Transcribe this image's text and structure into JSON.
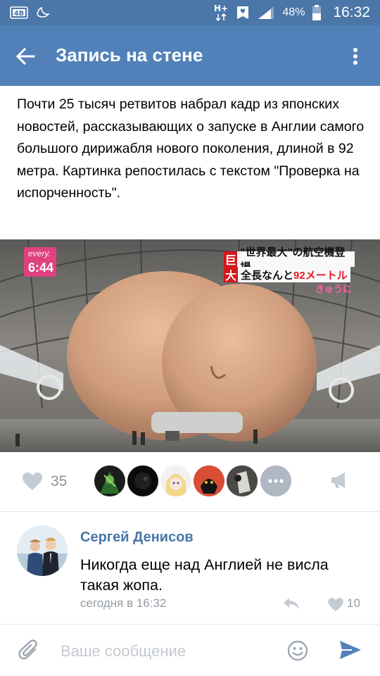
{
  "status_bar": {
    "sim_label": "4B",
    "network": "H+",
    "battery": "48%",
    "time": "16:32",
    "icons": [
      "sim-icon",
      "moon-icon",
      "data-arrows-icon",
      "heart-notification-icon",
      "signal-icon",
      "battery-icon"
    ]
  },
  "app_bar": {
    "title": "Запись на стене",
    "back_icon": "arrow-back-icon",
    "menu_icon": "more-vertical-icon",
    "color": "#5181b8"
  },
  "post": {
    "text": "Почти 25 тысяч ретвитов набрал кадр из японских новостей, рассказывающих о запуске в Англии самого большого дирижабля нового поколения, длиной в 92 метра. Картинка репостилась с текстом \"Проверка на испорченность\".",
    "photo": {
      "channel_label": "every.",
      "clock": "6:44",
      "caption_kanji_1": "巨",
      "caption_kanji_2": "大",
      "caption_line_1": "\"世界最大\"の航空機登場",
      "caption_line_2_prefix": "全長なんと",
      "caption_line_2_highlight": "92メートル",
      "caption_small": "きゅうに"
    }
  },
  "likes": {
    "count": "35",
    "like_icon": "heart-icon",
    "more_icon": "more-horizontal-icon",
    "share_icon": "megaphone-icon"
  },
  "comment": {
    "author": "Сергей Денисов",
    "text": "Никогда еще над Англией не висла такая жопа.",
    "time": "сегодня в 16:32",
    "likes": "10",
    "reply_icon": "reply-icon",
    "like_icon": "heart-icon"
  },
  "composer": {
    "placeholder": "Ваше сообщение",
    "value": "",
    "attach_icon": "paperclip-icon",
    "emoji_icon": "smile-icon",
    "send_icon": "send-icon"
  },
  "colors": {
    "accent": "#5181b8",
    "status_bar": "#4a76a8",
    "muted": "#939aa1"
  }
}
